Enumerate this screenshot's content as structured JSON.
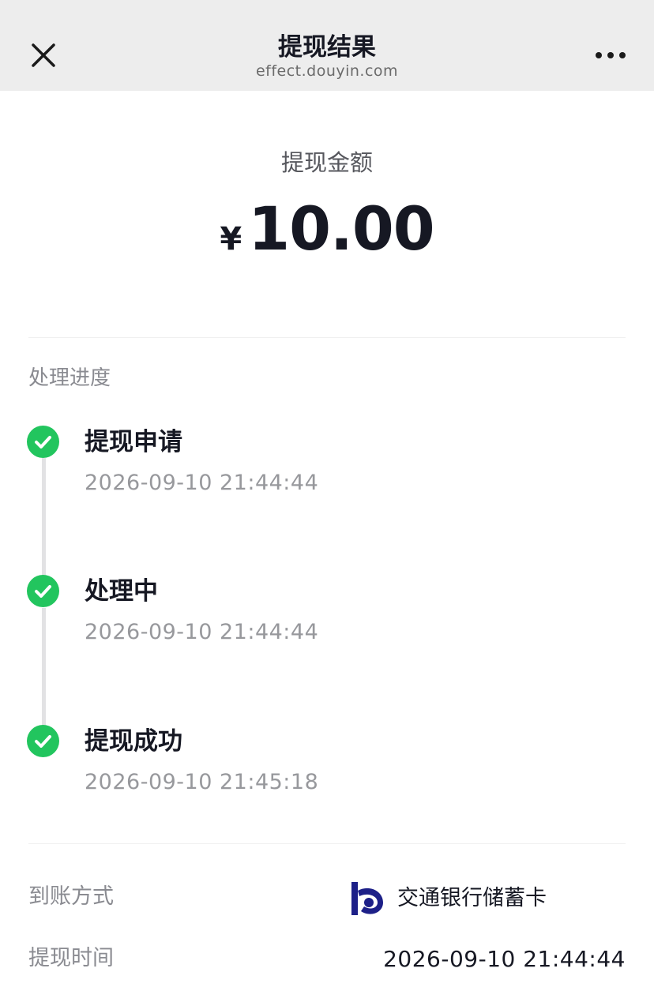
{
  "nav": {
    "title": "提现结果",
    "subtitle": "effect.douyin.com",
    "close_icon": "close-icon",
    "more_icon": "more-dots-icon"
  },
  "amount": {
    "label": "提现金额",
    "currency": "¥",
    "value": "10.00"
  },
  "progress": {
    "label": "处理进度",
    "steps": [
      {
        "title": "提现申请",
        "time": "2026-09-10 21:44:44",
        "icon": "check-circle-icon"
      },
      {
        "title": "处理中",
        "time": "2026-09-10 21:44:44",
        "icon": "check-circle-icon"
      },
      {
        "title": "提现成功",
        "time": "2026-09-10 21:45:18",
        "icon": "check-circle-icon"
      }
    ]
  },
  "details": {
    "method_label": "到账方式",
    "method_value": "交通银行储蓄卡",
    "bank_icon": "bank-logo-icon",
    "time_label": "提现时间",
    "time_value": "2026-09-10 21:44:44"
  },
  "colors": {
    "success": "#22c55e",
    "header_bg": "#ededed",
    "text_primary": "#161823",
    "text_secondary": "#8a8b91",
    "bank_brand": "#1d2088"
  }
}
